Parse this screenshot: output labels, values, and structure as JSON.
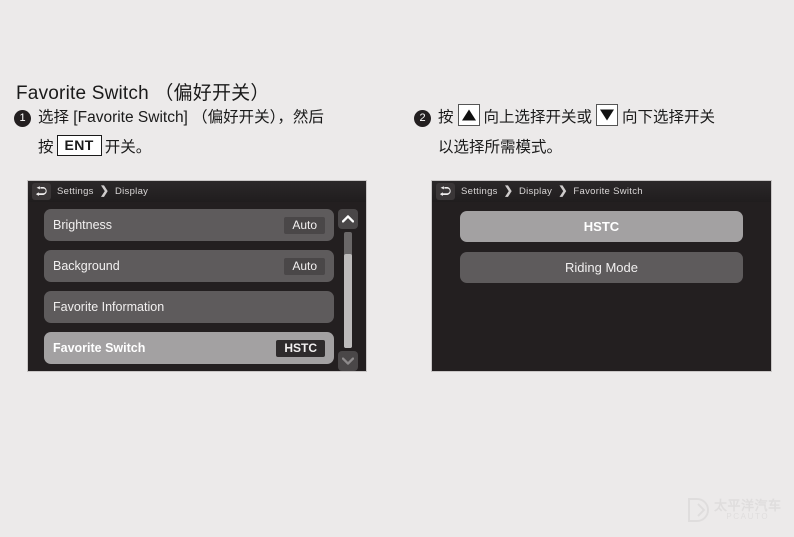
{
  "page": {
    "title": "Favorite Switch （偏好开关）"
  },
  "steps": [
    {
      "number": "❶",
      "number_text": "1",
      "line1_before": "选择 [Favorite Switch] （偏好开关），然后",
      "line2_before": "按",
      "key": "ENT",
      "line2_after": "开关。"
    },
    {
      "number": "❷",
      "number_text": "2",
      "line1_before": "按",
      "key_up": "triangle-up",
      "line1_mid": "向上选择开关或",
      "key_down": "triangle-down",
      "line1_after": "向下选择开关",
      "line2": "以选择所需模式。"
    }
  ],
  "left_screen": {
    "breadcrumb": {
      "back_icon": "back-arrow-icon",
      "items": [
        "Settings",
        "Display"
      ],
      "separator": "❯"
    },
    "rows": [
      {
        "label": "Brightness",
        "value": "Auto",
        "selected": false
      },
      {
        "label": "Background",
        "value": "Auto",
        "selected": false
      },
      {
        "label": "Favorite Information",
        "value": "",
        "selected": false
      },
      {
        "label": "Favorite Switch",
        "value": "HSTC",
        "selected": true
      }
    ],
    "scrollbar": {
      "up_icon": "chevron-up-icon",
      "down_icon": "chevron-down-icon"
    }
  },
  "right_screen": {
    "breadcrumb": {
      "back_icon": "back-arrow-icon",
      "items": [
        "Settings",
        "Display",
        "Favorite Switch"
      ],
      "separator": "❯"
    },
    "options": [
      {
        "label": "HSTC",
        "selected": true
      },
      {
        "label": "Riding Mode",
        "selected": false
      }
    ]
  },
  "watermark": {
    "cn": "太平洋汽车",
    "en": "PCAUTO"
  },
  "colors": {
    "page_bg": "#eceaea",
    "screen_bg": "#231f20",
    "row_bg": "#5e5b5c",
    "row_selected_bg": "#a3a1a2",
    "badge_bg": "#4a4748",
    "badge_selected_bg": "#2e2b2c",
    "text_light": "#f2f0f0",
    "text_dark": "#1a1a1a"
  }
}
